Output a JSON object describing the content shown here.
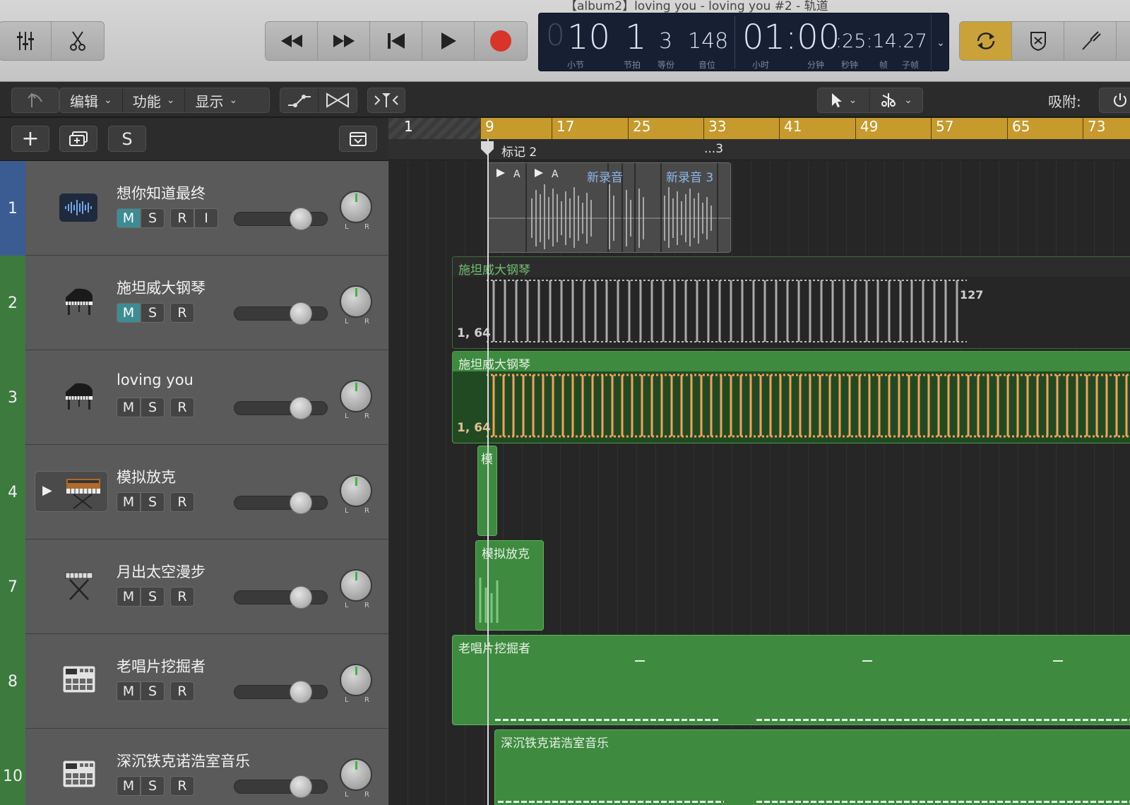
{
  "window": {
    "title": "【album2】loving  you - loving  you #2 - 轨道"
  },
  "lcd": {
    "bar_lead": "0",
    "bar": "10",
    "beat": "1",
    "division": "3",
    "tick": "148",
    "time_main": "01:00",
    "time_rest": ":25:14.27",
    "labels": [
      "小节",
      "节拍",
      "等份",
      "音位",
      "小时",
      "分钟",
      "秒钟",
      "帧",
      "子帧"
    ]
  },
  "toolbar": {
    "menus": [
      {
        "label": "编辑"
      },
      {
        "label": "功能"
      },
      {
        "label": "显示"
      }
    ],
    "snap_label": "吸附:"
  },
  "header_row": {
    "solo_label": "S"
  },
  "tracks": [
    {
      "num": "1",
      "name": "想你知道最终",
      "buttons": [
        "M",
        "S",
        "R",
        "I"
      ],
      "mute_on": true,
      "color": "#3a5c92",
      "icon": "waveform-icon"
    },
    {
      "num": "2",
      "name": "施坦威大钢琴",
      "buttons": [
        "M",
        "S",
        "R"
      ],
      "mute_on": true,
      "color": "#3c7a3e",
      "icon": "grand-piano-icon"
    },
    {
      "num": "3",
      "name": "loving you",
      "buttons": [
        "M",
        "S",
        "R"
      ],
      "mute_on": false,
      "color": "#3c7a3e",
      "icon": "grand-piano-icon"
    },
    {
      "num": "4",
      "name": "模拟放克",
      "buttons": [
        "M",
        "S",
        "R"
      ],
      "mute_on": false,
      "color": "#3c7a3e",
      "icon": "synth-icon"
    },
    {
      "num": "7",
      "name": "月出太空漫步",
      "buttons": [
        "M",
        "S",
        "R"
      ],
      "mute_on": false,
      "color": "#3c7a3e",
      "icon": "keyboard-stand-icon"
    },
    {
      "num": "8",
      "name": "老唱片挖掘者",
      "buttons": [
        "M",
        "S",
        "R"
      ],
      "mute_on": false,
      "color": "#3c7a3e",
      "icon": "drum-machine-icon"
    },
    {
      "num": "10",
      "name": "深沉铁克诺浩室音乐",
      "buttons": [
        "M",
        "S",
        "R"
      ],
      "mute_on": false,
      "color": "#3c7a3e",
      "icon": "drum-machine-icon"
    }
  ],
  "pan_labels": {
    "left": "L",
    "right": "R"
  },
  "ruler": {
    "start": "1",
    "bars": [
      "9",
      "17",
      "25",
      "33",
      "41",
      "49",
      "57",
      "65",
      "73"
    ]
  },
  "markers": {
    "marker_2": "标记 2",
    "marker_3": "...3"
  },
  "regions": {
    "audio": [
      "新录音",
      "新录音 3"
    ],
    "steinway_a": {
      "name": "施坦威大钢琴",
      "left_val": "1, 64",
      "right_val": "127"
    },
    "steinway_b": {
      "name": "施坦威大钢琴",
      "left_val": "1, 64"
    },
    "funk_small": {
      "name": "模"
    },
    "funk": {
      "name": "模拟放克"
    },
    "digger": {
      "name": "老唱片挖掘者"
    },
    "techno": {
      "name": "深沉铁克诺浩室音乐"
    }
  },
  "colors": {
    "region_green": "#3e8a3f",
    "midi_orange": "#f0a35a",
    "ruler_gold": "#c69a2c",
    "cycle_gold": "#c9a23a",
    "record_red": "#d8352a"
  }
}
